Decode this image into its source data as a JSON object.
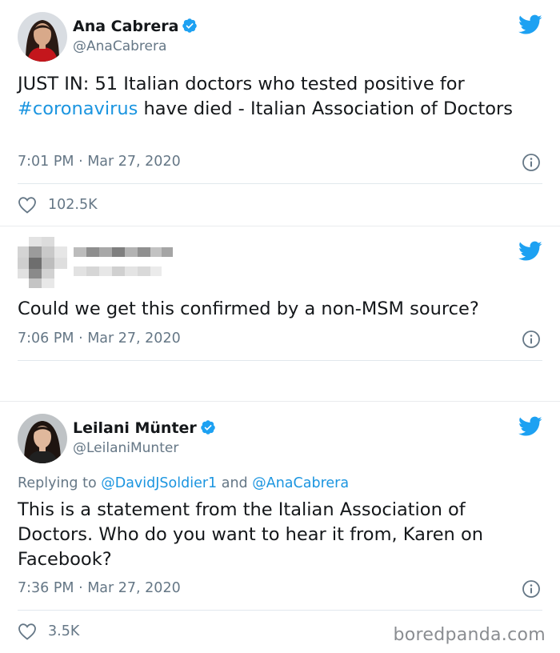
{
  "tweets": [
    {
      "author_name": "Ana Cabrera",
      "handle": "@AnaCabrera",
      "verified": true,
      "text_before": "JUST IN: 51 Italian doctors who tested positive for ",
      "hashtag": "#coronavirus",
      "text_after": " have died - Italian Association of Doctors",
      "time": "7:01 PM · Mar 27, 2020",
      "likes": "102.5K"
    },
    {
      "author_hidden": true,
      "text": "Could we get this confirmed by a non-MSM source?",
      "time": "7:06 PM · Mar 27, 2020"
    },
    {
      "author_name": "Leilani Münter",
      "handle": "@LeilaniMunter",
      "verified": true,
      "reply_prefix": "Replying to ",
      "reply_mention_1": "@DavidJSoldier1",
      "reply_and": " and ",
      "reply_mention_2": "@AnaCabrera",
      "text": "This is a statement from the Italian Association of Doctors. Who do you want to hear it from, Karen on Facebook?",
      "time": "7:36 PM · Mar 27, 2020",
      "likes": "3.5K"
    }
  ],
  "icons": {
    "platform": "twitter-bird-icon",
    "verified": "verified-badge-icon",
    "info": "info-icon",
    "like": "heart-icon"
  },
  "colors": {
    "twitter_blue": "#1da1f2",
    "link_blue": "#1b95e0",
    "secondary_text": "#657786"
  },
  "watermark": "boredpanda.com"
}
